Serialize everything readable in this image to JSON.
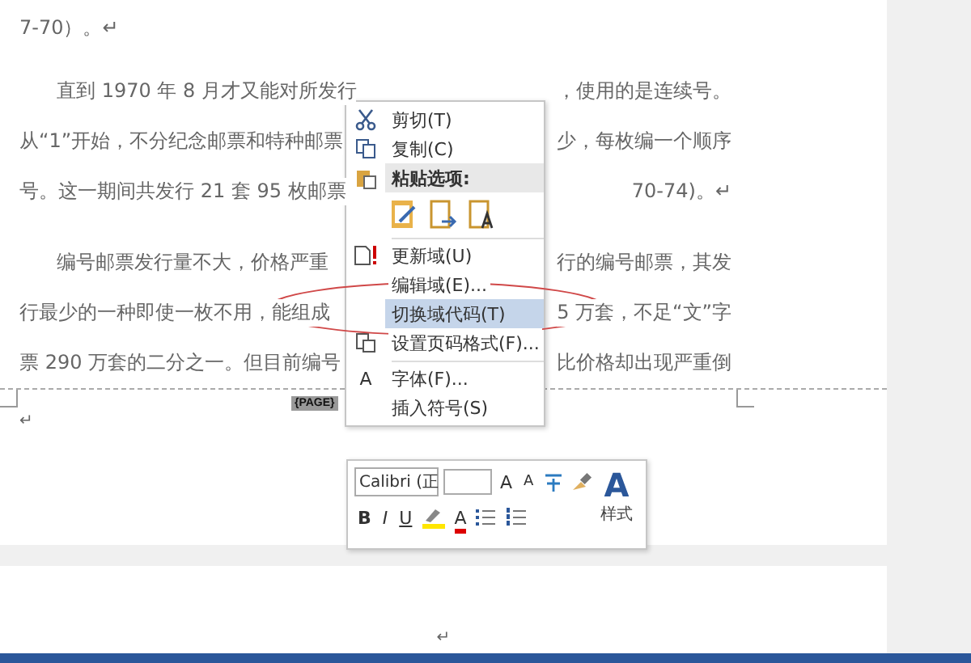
{
  "document": {
    "lines": [
      {
        "left": "7-70）。↵",
        "indent": false
      },
      {
        "left": "直到 1970 年 8 月才又能对所发行",
        "right": "，使用的是连续号。",
        "indent": true
      },
      {
        "left": "从“1”开始，不分纪念邮票和特种邮票",
        "right": "少，每枚编一个顺序",
        "indent": false
      },
      {
        "left": "号。这一期间共发行 21 套 95 枚邮票",
        "right": "70-74)。↵",
        "indent": false
      },
      {
        "left": "编号邮票发行量不大，价格严重",
        "right": "行的编号邮票，其发",
        "indent": true
      },
      {
        "left": "行最少的一种即使一枚不用，能组成",
        "right": "5 万套，不足“文”字",
        "indent": false
      },
      {
        "left": "票 290 万套的二分之一。但目前编号",
        "right": "比价格却出现严重倒",
        "indent": false
      }
    ],
    "footer_field": "{PAGE}",
    "footer_mark": "↵",
    "next_page_mark": "↵"
  },
  "context_menu": {
    "items": [
      {
        "kind": "item",
        "label": "剪切(T)",
        "selected": false
      },
      {
        "kind": "item",
        "label": "复制(C)",
        "selected": false
      },
      {
        "kind": "header",
        "label": "粘贴选项:"
      },
      {
        "kind": "paste"
      },
      {
        "kind": "separator"
      },
      {
        "kind": "item",
        "label": "更新域(U)",
        "selected": false
      },
      {
        "kind": "item",
        "label": "编辑域(E)...",
        "selected": false
      },
      {
        "kind": "item",
        "label": "切换域代码(T)",
        "selected": true
      },
      {
        "kind": "item",
        "label": "设置页码格式(F)...",
        "selected": false
      },
      {
        "kind": "separator"
      },
      {
        "kind": "item",
        "label": "字体(F)...",
        "selected": false,
        "glyph": "A"
      },
      {
        "kind": "item",
        "label": "插入符号(S)",
        "selected": false
      }
    ]
  },
  "mini_toolbar": {
    "font": "Calibri (正",
    "grow_font": "A",
    "shrink_font": "A",
    "format_buttons": [
      "B",
      "I",
      "U"
    ],
    "font_color": "A",
    "styles_glyph": "A",
    "styles_label": "样式"
  }
}
